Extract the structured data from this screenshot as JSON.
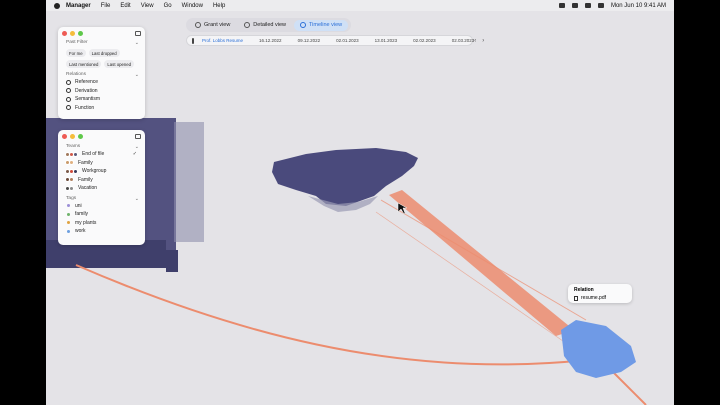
{
  "menubar": {
    "app": "Manager",
    "menus": [
      "File",
      "Edit",
      "View",
      "Go",
      "Window",
      "Help"
    ],
    "clock": "Mon Jun 10  9:41 AM"
  },
  "views": {
    "tabs": [
      {
        "label": "Grant view",
        "active": false
      },
      {
        "label": "Detailed view",
        "active": false
      },
      {
        "label": "Timeline view",
        "active": true
      }
    ]
  },
  "timeline": {
    "file": "Prof. Lobbs Resume",
    "dates": [
      "16.12.2022",
      "09.12.2022",
      "02.01.2023",
      "13.01.2023",
      "02.02.2023",
      "02.03.2023"
    ]
  },
  "filter_panel": {
    "section_past": "Past Filter",
    "chips": [
      "For me",
      "Last dropped",
      "Last mentioned",
      "Last opened"
    ],
    "section_relations": "Relations",
    "relations": [
      "Reference",
      "Derivation",
      "Semantism",
      "Function"
    ]
  },
  "teams_panel": {
    "section_teams": "Teams",
    "teams": [
      {
        "label": "End of file",
        "checked": true
      },
      {
        "label": "Family",
        "checked": false
      },
      {
        "label": "Workgroup",
        "checked": false
      },
      {
        "label": "Family",
        "checked": false
      },
      {
        "label": "Vacation",
        "checked": false
      }
    ],
    "section_tags": "Tags",
    "tags": [
      {
        "label": "uni",
        "color": "#9b8fd6"
      },
      {
        "label": "family",
        "color": "#6fb36b"
      },
      {
        "label": "my plants",
        "color": "#e0a341"
      },
      {
        "label": "work",
        "color": "#6ea0e0"
      }
    ]
  },
  "relation_popup": {
    "title": "Relation",
    "file": "resume.pdf"
  },
  "colors": {
    "cluster_purple": "#4a4a7c",
    "cluster_blue": "#6f9ae6",
    "link_orange": "#ec8c6e",
    "accent": "#2a6fd8"
  }
}
